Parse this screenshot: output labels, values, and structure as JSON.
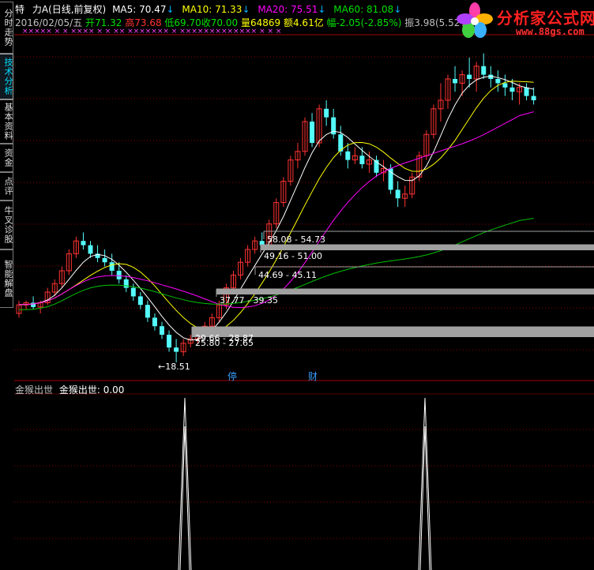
{
  "side_tabs": [
    {
      "label": "分时走势",
      "active": false
    },
    {
      "label": "技术分析",
      "active": true
    },
    {
      "label": "基本资料",
      "active": false
    },
    {
      "label": "资金",
      "active": false
    },
    {
      "label": "点评",
      "active": false
    },
    {
      "label": "牛叉诊股",
      "active": false
    },
    {
      "label": "智能解盘",
      "active": false
    }
  ],
  "header": {
    "line1": {
      "prefix": "特",
      "name": "力A",
      "mode": "(日线,前复权)",
      "ma5": "MA5: 70.47",
      "ma10": "MA10: 71.33",
      "ma20": "MA20: 75.51",
      "ma60": "MA60: 81.08",
      "arrow": "↓"
    },
    "line2": {
      "date": "2016/02/05/五",
      "open": "开71.32",
      "high": "高73.68",
      "low": "低69.70",
      "close": "收70.00",
      "volume": "量64869",
      "amount": "额4.61亿",
      "change": "幅-2.05(-2.85%)",
      "amplitude": "振3.98(5.52%)"
    },
    "marker_row": "×××××  ×  ×      ××××  ×     ×  ××  ×××××××  ×  ×××××××××××××  ×  ×  ×"
  },
  "logo": {
    "title": "分析家公式网",
    "url": "www.88gs.com"
  },
  "colors": {
    "up": "#ff3232",
    "down": "#54fcfc",
    "ma5": "#ffffff",
    "ma10": "#ffff00",
    "ma20": "#ff00ff",
    "ma60": "#00c000",
    "zone": "#a0a0a0",
    "grid": "#800000"
  },
  "zones": [
    {
      "label": "58.08 - 54.73"
    },
    {
      "label": "49.16 - 51.00"
    },
    {
      "label": "44.69 - 45.11"
    },
    {
      "label": "37.77 - 39.35"
    },
    {
      "label": "29.66 - 28.87"
    },
    {
      "label": "25.80 - 27.65"
    }
  ],
  "low_label": "18.51",
  "events": [
    {
      "label": "停"
    },
    {
      "label": "财"
    }
  ],
  "indicator": {
    "title": "金猴出世",
    "label": "金猴出世: 0.00"
  },
  "chart_data": {
    "type": "candlestick",
    "price_range": [
      15,
      95
    ],
    "series": [
      {
        "name": "MA5",
        "value": 70.47
      },
      {
        "name": "MA10",
        "value": 71.33
      },
      {
        "name": "MA20",
        "value": 75.51
      },
      {
        "name": "MA60",
        "value": 81.08
      }
    ],
    "candles": [
      [
        30,
        33,
        29,
        32
      ],
      [
        32,
        33,
        31,
        32.5
      ],
      [
        32.5,
        34,
        31,
        31.5
      ],
      [
        31.5,
        33,
        30,
        32.5
      ],
      [
        32.5,
        36,
        32,
        35
      ],
      [
        35,
        38,
        34,
        37
      ],
      [
        37,
        41,
        36,
        40
      ],
      [
        40,
        45,
        39,
        44
      ],
      [
        44,
        48,
        43,
        47
      ],
      [
        47,
        49,
        45,
        46
      ],
      [
        46,
        47,
        43,
        44
      ],
      [
        44,
        46,
        42,
        43
      ],
      [
        43,
        45,
        41,
        42
      ],
      [
        42,
        44,
        39,
        40
      ],
      [
        40,
        42,
        37,
        38
      ],
      [
        38,
        39,
        35,
        36
      ],
      [
        36,
        37,
        33,
        34
      ],
      [
        34,
        35,
        31,
        32
      ],
      [
        32,
        33,
        28,
        29
      ],
      [
        29,
        30,
        26,
        27
      ],
      [
        27,
        28,
        24,
        25
      ],
      [
        25,
        26,
        21,
        22
      ],
      [
        22,
        24,
        18.51,
        21
      ],
      [
        21,
        24,
        20,
        23
      ],
      [
        23,
        25,
        22,
        24
      ],
      [
        24,
        26,
        23,
        25.5
      ],
      [
        25.5,
        28,
        25,
        27
      ],
      [
        27,
        30,
        26,
        29
      ],
      [
        29,
        33,
        28,
        32
      ],
      [
        32,
        37,
        31,
        36
      ],
      [
        36,
        40,
        35,
        39
      ],
      [
        39,
        43,
        38,
        42
      ],
      [
        42,
        46,
        41,
        45
      ],
      [
        45,
        48,
        44,
        47
      ],
      [
        47,
        49,
        45,
        46
      ],
      [
        46,
        52,
        45,
        51
      ],
      [
        51,
        57,
        50,
        56
      ],
      [
        56,
        62,
        55,
        61
      ],
      [
        61,
        67,
        60,
        66
      ],
      [
        66,
        70,
        64,
        68
      ],
      [
        68,
        76,
        67,
        75
      ],
      [
        75,
        77,
        69,
        70
      ],
      [
        70,
        79,
        69,
        78
      ],
      [
        78,
        80,
        74,
        76
      ],
      [
        76,
        78,
        71,
        72
      ],
      [
        72,
        74,
        67,
        68
      ],
      [
        68,
        70,
        64,
        66
      ],
      [
        66,
        69,
        65,
        67
      ],
      [
        67,
        69,
        64,
        65
      ],
      [
        65,
        68,
        63,
        66
      ],
      [
        66,
        67,
        62,
        63
      ],
      [
        63,
        66,
        61,
        64
      ],
      [
        64,
        65,
        58,
        59
      ],
      [
        59,
        61,
        55,
        57
      ],
      [
        57,
        60,
        55,
        58
      ],
      [
        58,
        63,
        57,
        62
      ],
      [
        62,
        68,
        61,
        67
      ],
      [
        67,
        73,
        66,
        72
      ],
      [
        72,
        79,
        71,
        78
      ],
      [
        78,
        84,
        75,
        80
      ],
      [
        80,
        86,
        78,
        85
      ],
      [
        85,
        88,
        82,
        84
      ],
      [
        84,
        87,
        81,
        86
      ],
      [
        86,
        90,
        83,
        85
      ],
      [
        85,
        89,
        82,
        88
      ],
      [
        88,
        91,
        85,
        86
      ],
      [
        86,
        88,
        83,
        85
      ],
      [
        85,
        87,
        82,
        84
      ],
      [
        84,
        86,
        81,
        83
      ],
      [
        83,
        85,
        80,
        82
      ],
      [
        82,
        84,
        79,
        83
      ],
      [
        83,
        84,
        80,
        81
      ],
      [
        81,
        83,
        79,
        80
      ]
    ]
  }
}
